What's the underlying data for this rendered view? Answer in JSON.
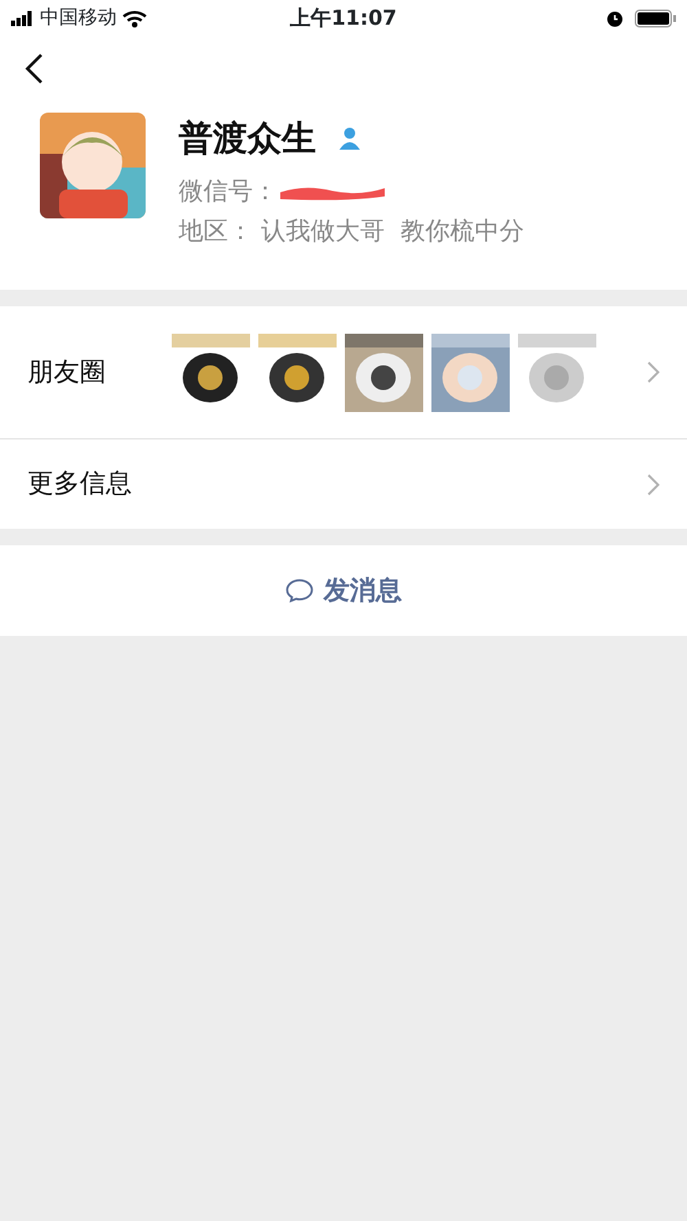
{
  "status_bar": {
    "carrier": "中国移动",
    "time": "上午11:07"
  },
  "profile": {
    "name": "普渡众生",
    "wechat_id_label": "微信号：",
    "region_label": "地区：",
    "region": "认我做大哥  教你梳中分"
  },
  "rows": [
    {
      "kind": "moments",
      "label": "朋友圈"
    },
    {
      "kind": "plain",
      "label": "更多信息"
    }
  ],
  "action": {
    "label": "发消息"
  }
}
